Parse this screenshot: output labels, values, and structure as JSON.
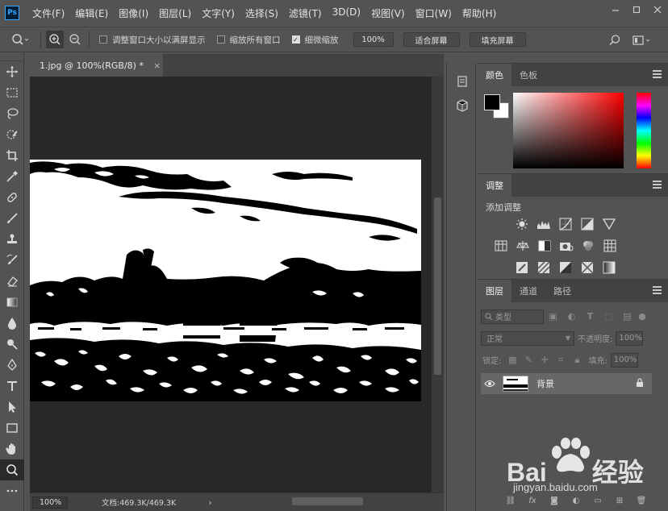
{
  "app": {
    "logo": "Ps"
  },
  "menu": [
    "文件(F)",
    "编辑(E)",
    "图像(I)",
    "图层(L)",
    "文字(Y)",
    "选择(S)",
    "滤镜(T)",
    "3D(D)",
    "视图(V)",
    "窗口(W)",
    "帮助(H)"
  ],
  "window_controls": [
    "minimize-icon",
    "restore-icon",
    "close-icon"
  ],
  "options": {
    "resize_windows": {
      "label": "调整窗口大小以满屏显示",
      "checked": false
    },
    "zoom_all_windows": {
      "label": "缩放所有窗口",
      "checked": false
    },
    "scrubby_zoom": {
      "label": "细微缩放",
      "checked": true
    },
    "zoom_100": "100%",
    "fit_screen": "适合屏幕",
    "fill_screen": "填充屏幕"
  },
  "document": {
    "tab_title": "1.jpg @ 100%(RGB/8) *",
    "close_glyph": "×",
    "status_zoom": "100%",
    "status_info": "文档:469.3K/469.3K"
  },
  "color_panel": {
    "tabs": [
      "颜色",
      "色板"
    ],
    "foreground": "#000000",
    "background": "#ffffff"
  },
  "adjust_panel": {
    "tab": "调整",
    "title": "添加调整"
  },
  "layers_panel": {
    "tabs": [
      "图层",
      "通道",
      "路径"
    ],
    "filter_kind": "类型",
    "blend_mode": "正常",
    "opacity_label": "不透明度:",
    "opacity_value": "100%",
    "lock_label": "锁定:",
    "fill_label": "填充:",
    "fill_value": "100%",
    "layers": [
      {
        "name": "背景",
        "visible": true,
        "locked": true
      }
    ]
  },
  "watermark": {
    "brand": "Bai",
    "brand_cn": "经验",
    "url": "jingyan.baidu.com"
  }
}
